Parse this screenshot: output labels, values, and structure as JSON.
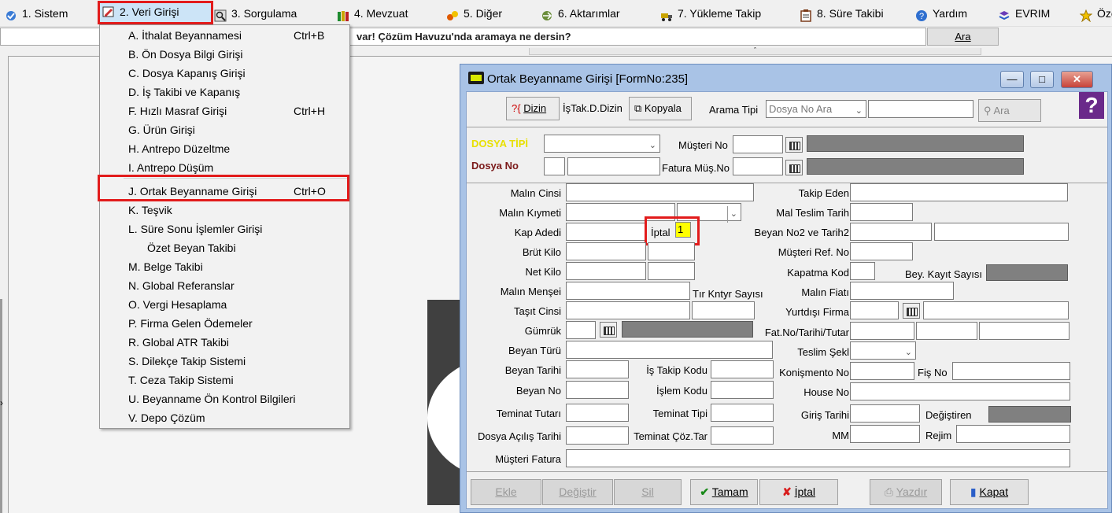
{
  "menubar": {
    "items": [
      {
        "label": "1.  Sistem",
        "icon": "system-icon"
      },
      {
        "label": "2.  Veri Girişi",
        "icon": "data-entry-icon"
      },
      {
        "label": "3.  Sorgulama",
        "icon": "query-icon"
      },
      {
        "label": "4.  Mevzuat",
        "icon": "books-icon"
      },
      {
        "label": "5.  Diğer",
        "icon": "tools-icon"
      },
      {
        "label": "6.  Aktarımlar",
        "icon": "transfer-icon"
      },
      {
        "label": "7.  Yükleme Takip",
        "icon": "truck-icon"
      },
      {
        "label": "8. Süre Takibi",
        "icon": "clipboard-icon"
      },
      {
        "label": "Yardım",
        "icon": "help-icon"
      },
      {
        "label": "EVRIM",
        "icon": "evrim-icon"
      },
      {
        "label": "Öze",
        "icon": "star-icon"
      }
    ]
  },
  "search": {
    "text": "var! Çözüm Havuzu'nda aramaya ne dersin?",
    "button": "Ara"
  },
  "dropdown": {
    "items": [
      {
        "label": "A.  İthalat Beyannamesi",
        "shortcut": "Ctrl+B"
      },
      {
        "label": "B.  Ön Dosya Bilgi Girişi",
        "shortcut": ""
      },
      {
        "label": "C.  Dosya Kapanış Girişi",
        "shortcut": ""
      },
      {
        "label": "D.  İş Takibi ve Kapanış",
        "shortcut": ""
      },
      {
        "label": "F.  Hızlı Masraf Girişi",
        "shortcut": "Ctrl+H"
      },
      {
        "label": "G.  Ürün Girişi",
        "shortcut": ""
      },
      {
        "label": "H.  Antrepo Düzeltme",
        "shortcut": ""
      },
      {
        "label": "I.  Antrepo Düşüm",
        "shortcut": ""
      },
      {
        "label": "J.  Ortak Beyanname Girişi",
        "shortcut": "Ctrl+O"
      },
      {
        "label": "K.  Teşvik",
        "shortcut": ""
      },
      {
        "label": "L.  Süre Sonu İşlemler Girişi",
        "shortcut": ""
      },
      {
        "label": "Özet Beyan Takibi",
        "shortcut": ""
      },
      {
        "label": "M.  Belge Takibi",
        "shortcut": ""
      },
      {
        "label": "N. Global Referanslar",
        "shortcut": ""
      },
      {
        "label": "O. Vergi Hesaplama",
        "shortcut": ""
      },
      {
        "label": "P. Firma Gelen Ödemeler",
        "shortcut": ""
      },
      {
        "label": "R. Global ATR Takibi",
        "shortcut": ""
      },
      {
        "label": "S. Dilekçe Takip Sistemi",
        "shortcut": ""
      },
      {
        "label": "T. Ceza Takip Sistemi",
        "shortcut": ""
      },
      {
        "label": "U. Beyanname Ön Kontrol Bilgileri",
        "shortcut": ""
      },
      {
        "label": "V. Depo Çözüm",
        "shortcut": ""
      }
    ]
  },
  "window": {
    "title": "Ortak Beyanname Girişi [FormNo:235]",
    "toolbar": {
      "dizin": "Dizin",
      "istak": "İşTak.D.Dizin",
      "kopyala": "Kopyala",
      "arama_tipi_label": "Arama Tipi",
      "arama_tipi_value": "Dosya No Ara",
      "ara": "Ara"
    },
    "header": {
      "dosya_tipi": "DOSYA TİPİ",
      "dosya_no": "Dosya No",
      "musteri_no": "Müşteri No",
      "fatura_mus_no": "Fatura Müş.No"
    },
    "fields": {
      "malin_cinsi": "Malın Cinsi",
      "malin_kiymeti": "Malın Kıymeti",
      "kap_adedi": "Kap Adedi",
      "iptal": "İptal",
      "iptal_value": "1",
      "brut_kilo": "Brüt Kilo",
      "net_kilo": "Net Kilo",
      "malin_mensei": "Malın Menşei",
      "tir": "Tır Kntyr Sayısı",
      "tasit_cinsi": "Taşıt Cinsi",
      "gumruk": "Gümrük",
      "beyan_turu": "Beyan Türü",
      "beyan_tarihi": "Beyan Tarihi",
      "is_takip_kodu": "İş Takip Kodu",
      "beyan_no": "Beyan No",
      "islem_kodu": "İşlem Kodu",
      "teminat_tutari": "Teminat Tutarı",
      "teminat_tipi": "Teminat Tipi",
      "dosya_acilis": "Dosya Açılış Tarihi",
      "teminat_coz": "Teminat Çöz.Tar",
      "musteri_fatura": "Müşteri Fatura",
      "takip_eden": "Takip Eden",
      "mal_teslim": "Mal Teslim Tarih",
      "beyan_no2": "Beyan  No2 ve Tarih2",
      "musteri_ref": "Müşteri  Ref. No",
      "kapatma_kod": "Kapatma Kod",
      "bey_kayit": "Bey. Kayıt Sayısı",
      "malin_fiati": "Malın Fiatı",
      "yurtdisi_firma": "Yurtdışı Firma",
      "fat_no": "Fat.No/Tarihi/Tutar",
      "teslim_sekli": "Teslim Şekl",
      "konismento": "Konişmento No",
      "fis_no": "Fiş No",
      "house_no": "House No",
      "giris_tarihi": "Giriş Tarihi",
      "degistiren": "Değiştiren",
      "mm": "MM",
      "rejim": "Rejim"
    },
    "buttons": {
      "ekle": "Ekle",
      "degistir": "Değiştir",
      "sil": "Sil",
      "tamam": "Tamam",
      "iptal": "İptal",
      "yazdir": "Yazdır",
      "kapat": "Kapat"
    }
  },
  "colors": {
    "highlight": "#e21b1b",
    "dosya_tipi": "#e8e000",
    "dosya_no": "#7b1a1a",
    "title_bar": "#a9c3e6"
  }
}
